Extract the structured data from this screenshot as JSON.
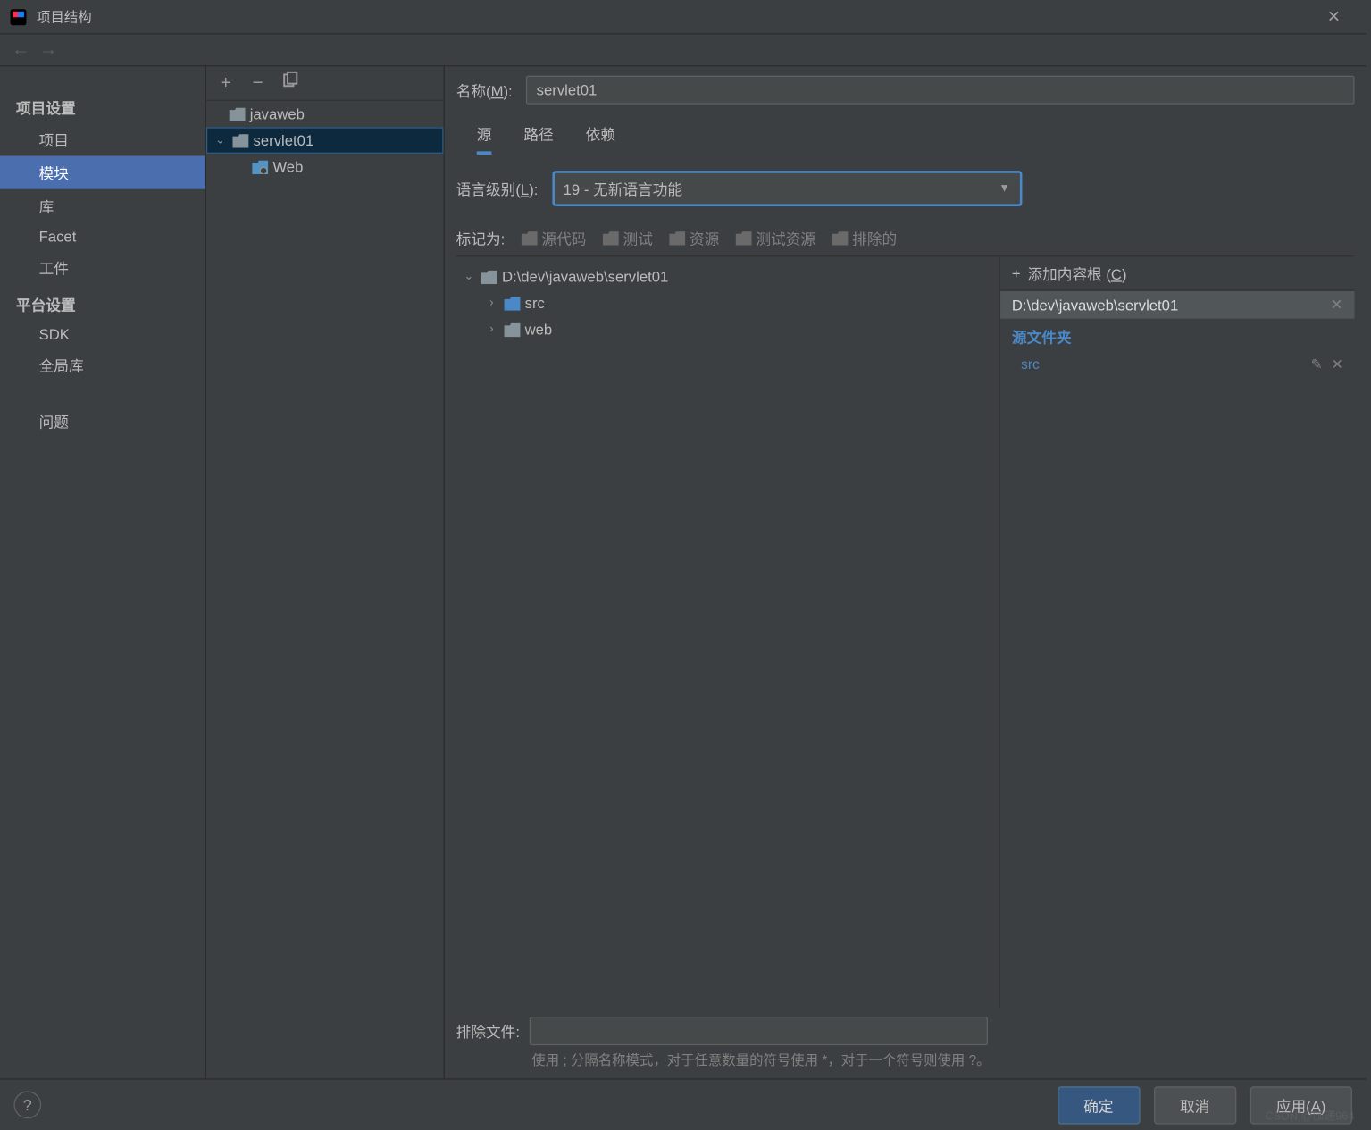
{
  "window": {
    "title": "项目结构"
  },
  "sidebar": {
    "sections": [
      {
        "header": "项目设置",
        "items": [
          "项目",
          "模块",
          "库",
          "Facet",
          "工件"
        ]
      },
      {
        "header": "平台设置",
        "items": [
          "SDK",
          "全局库"
        ]
      }
    ],
    "extra": "问题",
    "selected": "模块"
  },
  "modules_tree": [
    {
      "name": "javaweb",
      "indent": 0,
      "expanded": false
    },
    {
      "name": "servlet01",
      "indent": 0,
      "expanded": true,
      "selected": true
    },
    {
      "name": "Web",
      "indent": 1,
      "icon": "web"
    }
  ],
  "details": {
    "name_label_pre": "名称(",
    "name_label_u": "M",
    "name_label_post": "):",
    "name_value": "servlet01",
    "tabs": [
      "源",
      "路径",
      "依赖"
    ],
    "active_tab": "源",
    "lang_label_pre": "语言级别(",
    "lang_label_u": "L",
    "lang_label_post": "):",
    "lang_value": "19 - 无新语言功能",
    "mark_label": "标记为:",
    "marks": [
      "源代码",
      "测试",
      "资源",
      "测试资源",
      "排除的"
    ],
    "content_root_path": "D:\\dev\\javaweb\\servlet01",
    "tree_folders": [
      "src",
      "web"
    ],
    "add_content_root_pre": "添加内容根 (",
    "add_content_root_u": "C",
    "add_content_root_post": ")",
    "source_folder_label": "源文件夹",
    "source_folders": [
      "src"
    ],
    "exclude_label": "排除文件:",
    "exclude_hint": "使用 ; 分隔名称模式，对于任意数量的符号使用 *，对于一个符号则使用 ?。"
  },
  "buttons": {
    "ok": "确定",
    "cancel": "取消",
    "apply_pre": "应用(",
    "apply_u": "A",
    "apply_post": ")"
  },
  "watermark": "CSDN @伽递964"
}
